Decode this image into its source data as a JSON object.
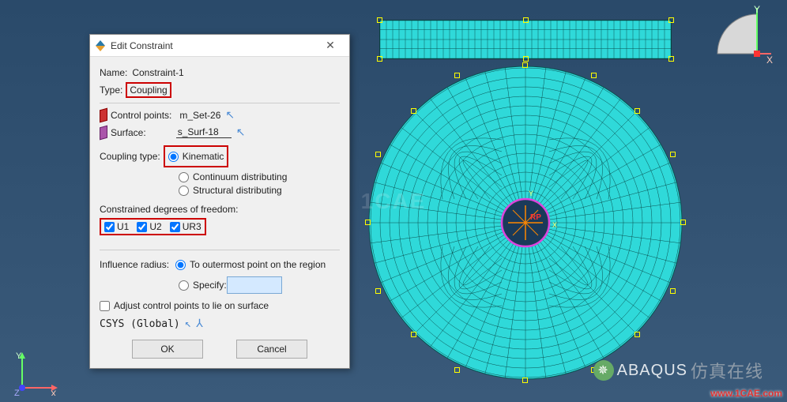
{
  "dialog": {
    "title": "Edit Constraint",
    "close": "✕",
    "name_label": "Name:",
    "name_value": "Constraint-1",
    "type_label": "Type:",
    "type_value": "Coupling",
    "control_points_label": "Control points:",
    "control_points_value": "m_Set-26",
    "surface_label": "Surface:",
    "surface_value": "s_Surf-18",
    "coupling_type_label": "Coupling type:",
    "coupling_options": {
      "kinematic": "Kinematic",
      "continuum": "Continuum distributing",
      "structural": "Structural distributing"
    },
    "constrained_dof_label": "Constrained degrees of freedom:",
    "dof": {
      "u1": "U1",
      "u2": "U2",
      "ur3": "UR3"
    },
    "influence_label": "Influence radius:",
    "influence_options": {
      "outermost": "To outermost point on the region",
      "specify": "Specify:"
    },
    "specify_value": "",
    "adjust_label": "Adjust control points to lie on surface",
    "csys_label": "CSYS (Global)",
    "ok": "OK",
    "cancel": "Cancel"
  },
  "viewport": {
    "axis_x": "X",
    "axis_y": "Y",
    "axis_z": "Z",
    "rp_label": "RP",
    "watermark_center": "1CAE",
    "watermark_url": "www.1CAE.com",
    "abaqus": "ABAQUS",
    "abaqus_cn": "仿真在线"
  }
}
